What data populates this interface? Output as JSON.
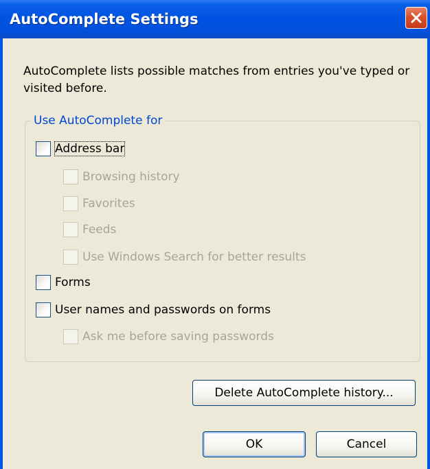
{
  "window": {
    "title": "AutoComplete Settings"
  },
  "description": "AutoComplete lists possible matches from entries you've typed or visited before.",
  "group": {
    "legend": "Use AutoComplete for",
    "options": [
      {
        "label": "Address bar",
        "checked": false,
        "enabled": true
      },
      {
        "label": "Browsing history",
        "checked": false,
        "enabled": false
      },
      {
        "label": "Favorites",
        "checked": false,
        "enabled": false
      },
      {
        "label": "Feeds",
        "checked": false,
        "enabled": false
      },
      {
        "label": "Use Windows Search for better results",
        "checked": false,
        "enabled": false
      },
      {
        "label": "Forms",
        "checked": false,
        "enabled": true
      },
      {
        "label": "User names and passwords on forms",
        "checked": false,
        "enabled": true
      },
      {
        "label": "Ask me before saving passwords",
        "checked": false,
        "enabled": false
      }
    ]
  },
  "buttons": {
    "delete_history": "Delete AutoComplete history...",
    "ok": "OK",
    "cancel": "Cancel"
  },
  "colors": {
    "titlebar": "#0054e3",
    "close": "#d8512b",
    "legend": "#0046d5",
    "dialog_bg": "#ece9d8"
  }
}
